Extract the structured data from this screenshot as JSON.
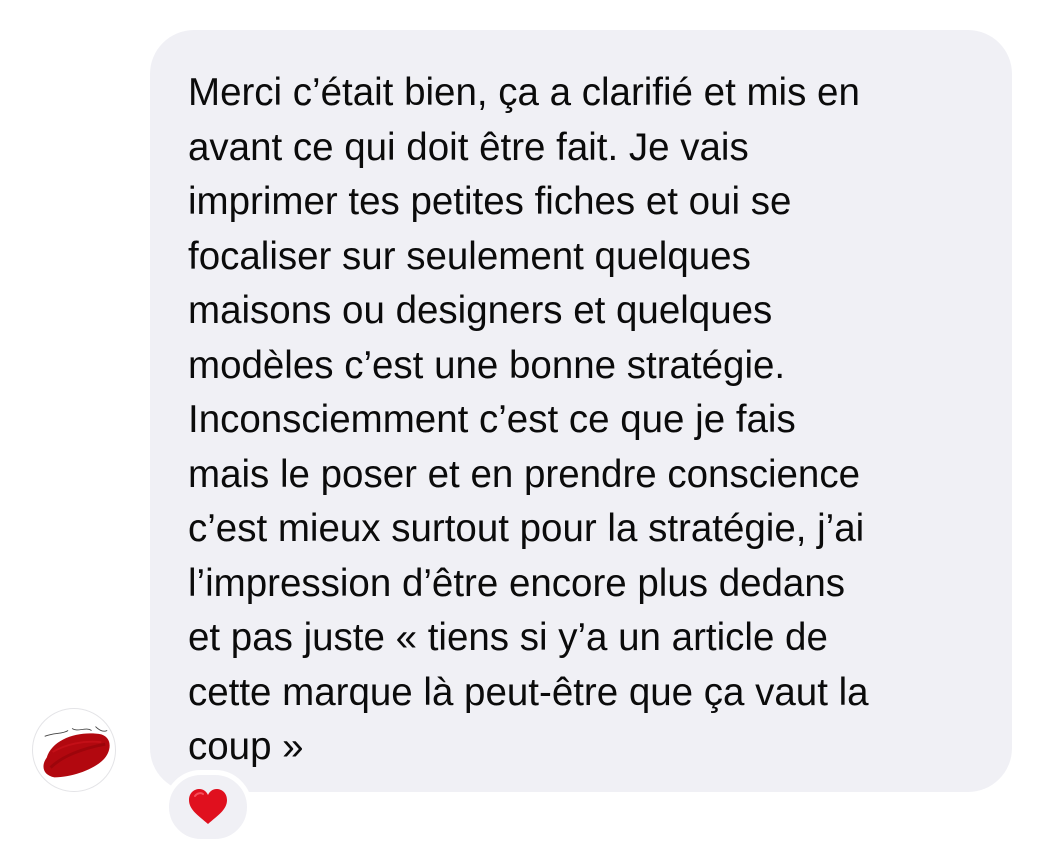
{
  "conversation": {
    "sender_avatar": {
      "description": "red brush stroke"
    },
    "message": {
      "lines": [
        "Merci c’était bien, ça a clarifié et mis en",
        "avant ce qui doit être fait. Je vais",
        "imprimer tes petites fiches et oui se",
        "focaliser sur seulement quelques",
        "maisons ou designers et quelques",
        "modèles c’est une bonne stratégie.",
        "Inconsciemment c’est ce que je fais",
        "mais le poser et en prendre conscience",
        "c’est mieux surtout pour la stratégie, j’ai",
        "l’impression d’être encore plus dedans",
        "et pas juste «  tiens si y’a un article de",
        "cette marque là peut-être que ça vaut la",
        "coup »"
      ],
      "bubble_color": "#f0f0f5",
      "text_color": "#0b0b0b"
    },
    "reaction": {
      "icon": "red-heart-icon",
      "color": "#e0101e"
    }
  }
}
